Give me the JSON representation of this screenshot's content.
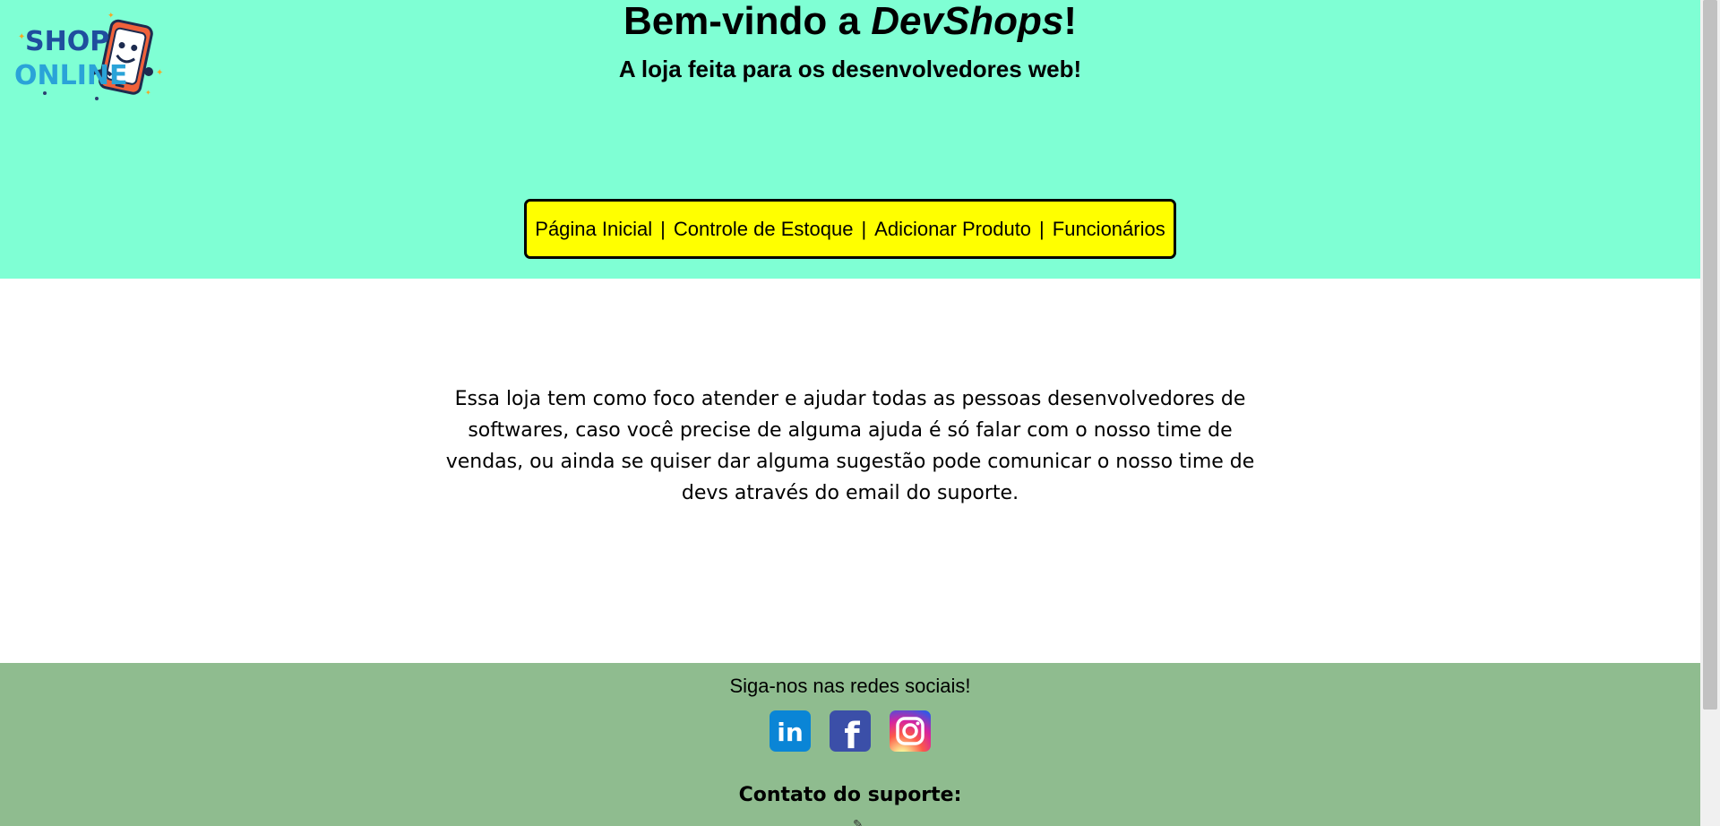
{
  "header": {
    "title_prefix": "Bem-vindo a ",
    "title_brand": "DevShops",
    "title_suffix": "!",
    "subtitle": "A loja feita para os desenvolvedores web!",
    "logo": {
      "line1": "SHOP",
      "line2": "ONLINE",
      "icon": "smartphone-mascot-icon"
    }
  },
  "nav": {
    "items": [
      {
        "label": "Página Inicial"
      },
      {
        "label": "Controle de Estoque"
      },
      {
        "label": "Adicionar Produto"
      },
      {
        "label": "Funcionários"
      }
    ],
    "separator": "|"
  },
  "main": {
    "intro": "Essa loja tem como foco atender e ajudar todas as pessoas desenvolvedores de softwares, caso você precise de alguma ajuda é só falar com o nosso time de vendas, ou ainda se quiser dar alguma sugestão pode comunicar o nosso time de devs através do email do suporte."
  },
  "footer": {
    "follow_text": "Siga-nos nas redes sociais!",
    "socials": [
      {
        "name": "LinkedIn",
        "icon": "linkedin-icon",
        "text": "in"
      },
      {
        "name": "Facebook",
        "icon": "facebook-icon",
        "text": "f"
      },
      {
        "name": "Instagram",
        "icon": "instagram-icon"
      }
    ],
    "support_label": "Contato do suporte:",
    "support_icon": "pen-icon"
  },
  "colors": {
    "header_bg": "#7fffd4",
    "nav_bg": "#ffff00",
    "footer_bg": "#8fbc8f"
  }
}
